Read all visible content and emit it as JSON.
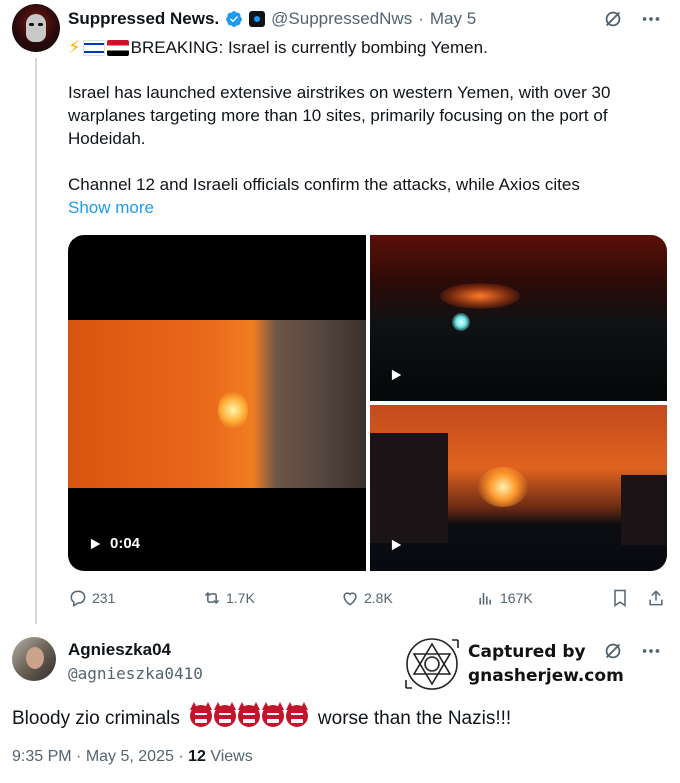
{
  "tweet": {
    "author_name": "Suppressed News.",
    "handle": "@SuppressedNws",
    "date": "May 5",
    "separator": "·",
    "headline": "BREAKING: Israel is currently bombing Yemen.",
    "paragraph1": "Israel has launched extensive airstrikes on western Yemen, with over 30 warplanes targeting more than 10 sites, primarily focusing on the port of Hodeidah.",
    "paragraph2": "Channel 12 and Israeli officials confirm the attacks, while Axios cites",
    "show_more": "Show more",
    "video_duration": "0:04",
    "replies": "231",
    "reposts": "1.7K",
    "likes": "2.8K",
    "views": "167K",
    "accent_color": "#1d9bf0"
  },
  "reply": {
    "author_name": "Agnieszka04",
    "handle": "@agnieszka0410",
    "text_before": "Bloody zio criminals",
    "text_after": "worse than the Nazis!!!",
    "time": "9:35 PM",
    "date": "May 5, 2025",
    "views_count": "12",
    "views_label": "Views"
  },
  "watermark": {
    "line1": "Captured by",
    "line2": "gnasherjew.com"
  },
  "icons": [
    "verified-badge-icon",
    "grok-icon",
    "more-icon",
    "play-icon",
    "reply-icon",
    "repost-icon",
    "like-icon",
    "views-icon",
    "bookmark-icon",
    "share-icon"
  ]
}
